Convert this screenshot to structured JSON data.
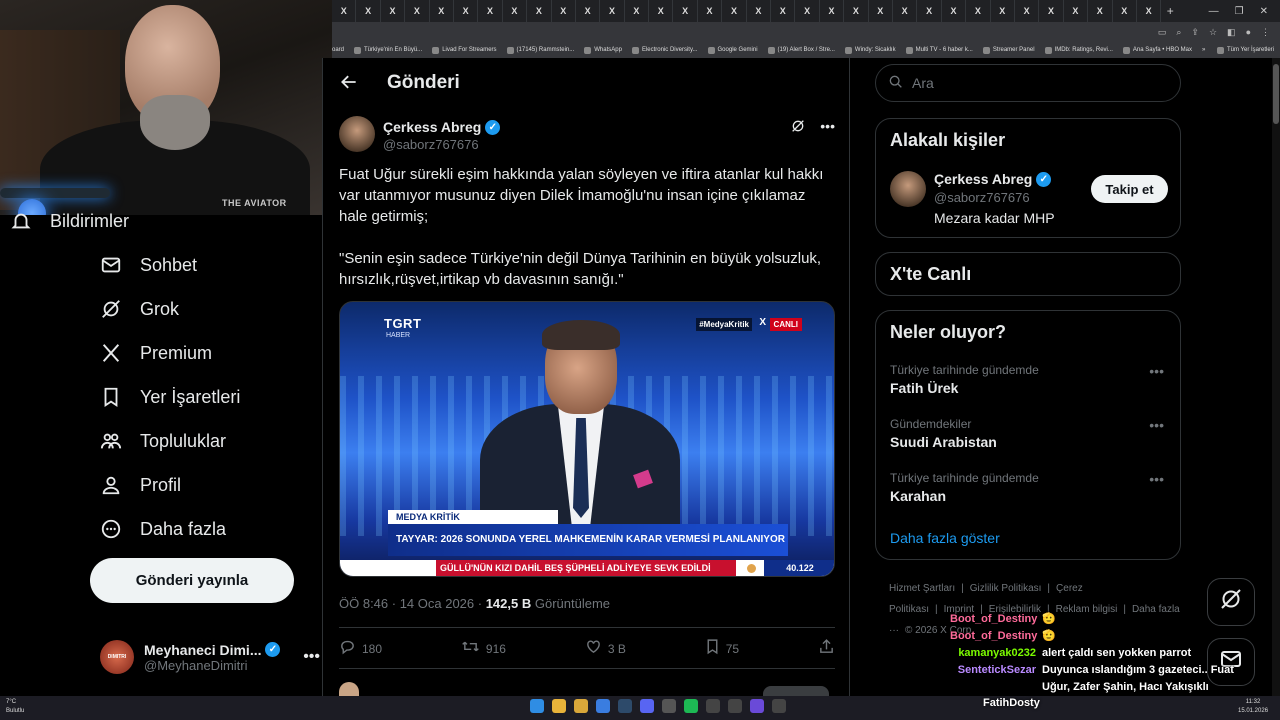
{
  "browser": {
    "tab_glyph": "X",
    "new_tab": "+",
    "bookmarks": [
      "oard",
      "Türkiye'nin En Büyü...",
      "Livad For Streamers",
      "(17145) Rammstein...",
      "WhatsApp",
      "Electronic Diversity...",
      "Google Gemini",
      "(19) Alert Box / Stre...",
      "Windy: Sicaklık",
      "Multi TV - 6 haber k...",
      "Streamer Panel",
      "IMDb: Ratings, Revi...",
      "Ana Sayfa • HBO Max"
    ],
    "bookmarks_overflow": "»",
    "all_bookmarks": "Tüm Yer İşaretleri"
  },
  "stream": {
    "shirt_text": "THE AVIATOR"
  },
  "nav": {
    "partial_item": "Bildirimler",
    "items": [
      {
        "label": "Sohbet",
        "icon": "mail-icon"
      },
      {
        "label": "Grok",
        "icon": "grok-icon"
      },
      {
        "label": "Premium",
        "icon": "x-logo-icon"
      },
      {
        "label": "Yer İşaretleri",
        "icon": "bookmark-icon"
      },
      {
        "label": "Topluluklar",
        "icon": "communities-icon"
      },
      {
        "label": "Profil",
        "icon": "profile-icon"
      },
      {
        "label": "Daha fazla",
        "icon": "more-circle-icon"
      }
    ],
    "post_button": "Gönderi yayınla",
    "account": {
      "name": "Meyhaneci Dimi...",
      "handle": "@MeyhaneDimitri",
      "avatar_text": "DIMITRI"
    }
  },
  "main": {
    "header_title": "Gönderi",
    "author": {
      "name": "Çerkess Abreg",
      "handle": "@saborz767676"
    },
    "text_p1": "Fuat Uğur sürekli eşim hakkında yalan söyleyen ve iftira atanlar kul hakkı var utanmıyor musunuz diyen Dilek İmamoğlu'nu insan içine çıkılamaz hale getirmiş;",
    "text_p2": "\"Senin eşin sadece Türkiye'nin değil Dünya Tarihinin en büyük yolsuzluk, hırsızlık,rüşvet,irtikap vb davasının sanığı.\"",
    "media": {
      "channel": "TGRT",
      "channel_sub": "HABER",
      "hashtag": "#MedyaKritik",
      "x_mark": "X",
      "live": "CANLI",
      "lower_label": "MEDYA KRİTİK",
      "lower_main": "TAYYAR: 2026 SONUNDA YEREL MAHKEMENİN KARAR VERMESİ PLANLANIYOR",
      "ticker": "GÜLLÜ'NÜN KIZI DAHİL BEŞ ŞÜPHELİ ADLİYEYE SEVK EDİLDİ",
      "ticker_num": "40.122"
    },
    "meta_time": "ÖÖ 8:46 · 14 Oca 2026 · ",
    "meta_views_count": "142,5 B",
    "meta_views_label": " Görüntüleme",
    "actions": {
      "reply": "180",
      "repost": "916",
      "like": "3 B",
      "bookmark": "75"
    }
  },
  "right": {
    "search_placeholder": "Ara",
    "related_title": "Alakalı kişiler",
    "related_user": {
      "name": "Çerkess Abreg",
      "handle": "@saborz767676",
      "bio": "Mezara kadar MHP",
      "follow": "Takip et"
    },
    "live_title": "X'te Canlı",
    "trends_title": "Neler oluyor?",
    "trends": [
      {
        "context": "Türkiye tarihinde gündemde",
        "name": "Fatih Ürek"
      },
      {
        "context": "Gündemdekiler",
        "name": "Suudi Arabistan"
      },
      {
        "context": "Türkiye tarihinde gündemde",
        "name": "Karahan"
      }
    ],
    "show_more": "Daha fazla göster",
    "footer": [
      "Hizmet Şartları",
      "|",
      "Gizlilik Politikası",
      "|",
      "Çerez Politikası",
      "|",
      "Imprint",
      "|",
      "Erişilebilirlik",
      "|",
      "Reklam bilgisi",
      "|",
      "Daha fazla ···",
      "© 2026 X Corp."
    ]
  },
  "chat": [
    {
      "user": "Boot_of_Destiny",
      "msg": "",
      "color": "#ff6b9a"
    },
    {
      "user": "Boot_of_Destiny",
      "msg": "",
      "color": "#ff6b9a"
    },
    {
      "user": "kamanyak0232",
      "msg": "alert çaldı sen yokken parrot",
      "color": "#7cfc00"
    },
    {
      "user": "SentetickSezar",
      "msg": "Duyunca ıslandığım 3 gazeteci.. Fuat Uğur, Zafer Şahin, Hacı Yakışıklı",
      "color": "#b98aff"
    }
  ],
  "taskbar": {
    "weather_temp": "7°C",
    "weather_desc": "Bulutlu",
    "streamer": "FatihDosty",
    "time": "11:32",
    "date": "15.01.2026"
  }
}
